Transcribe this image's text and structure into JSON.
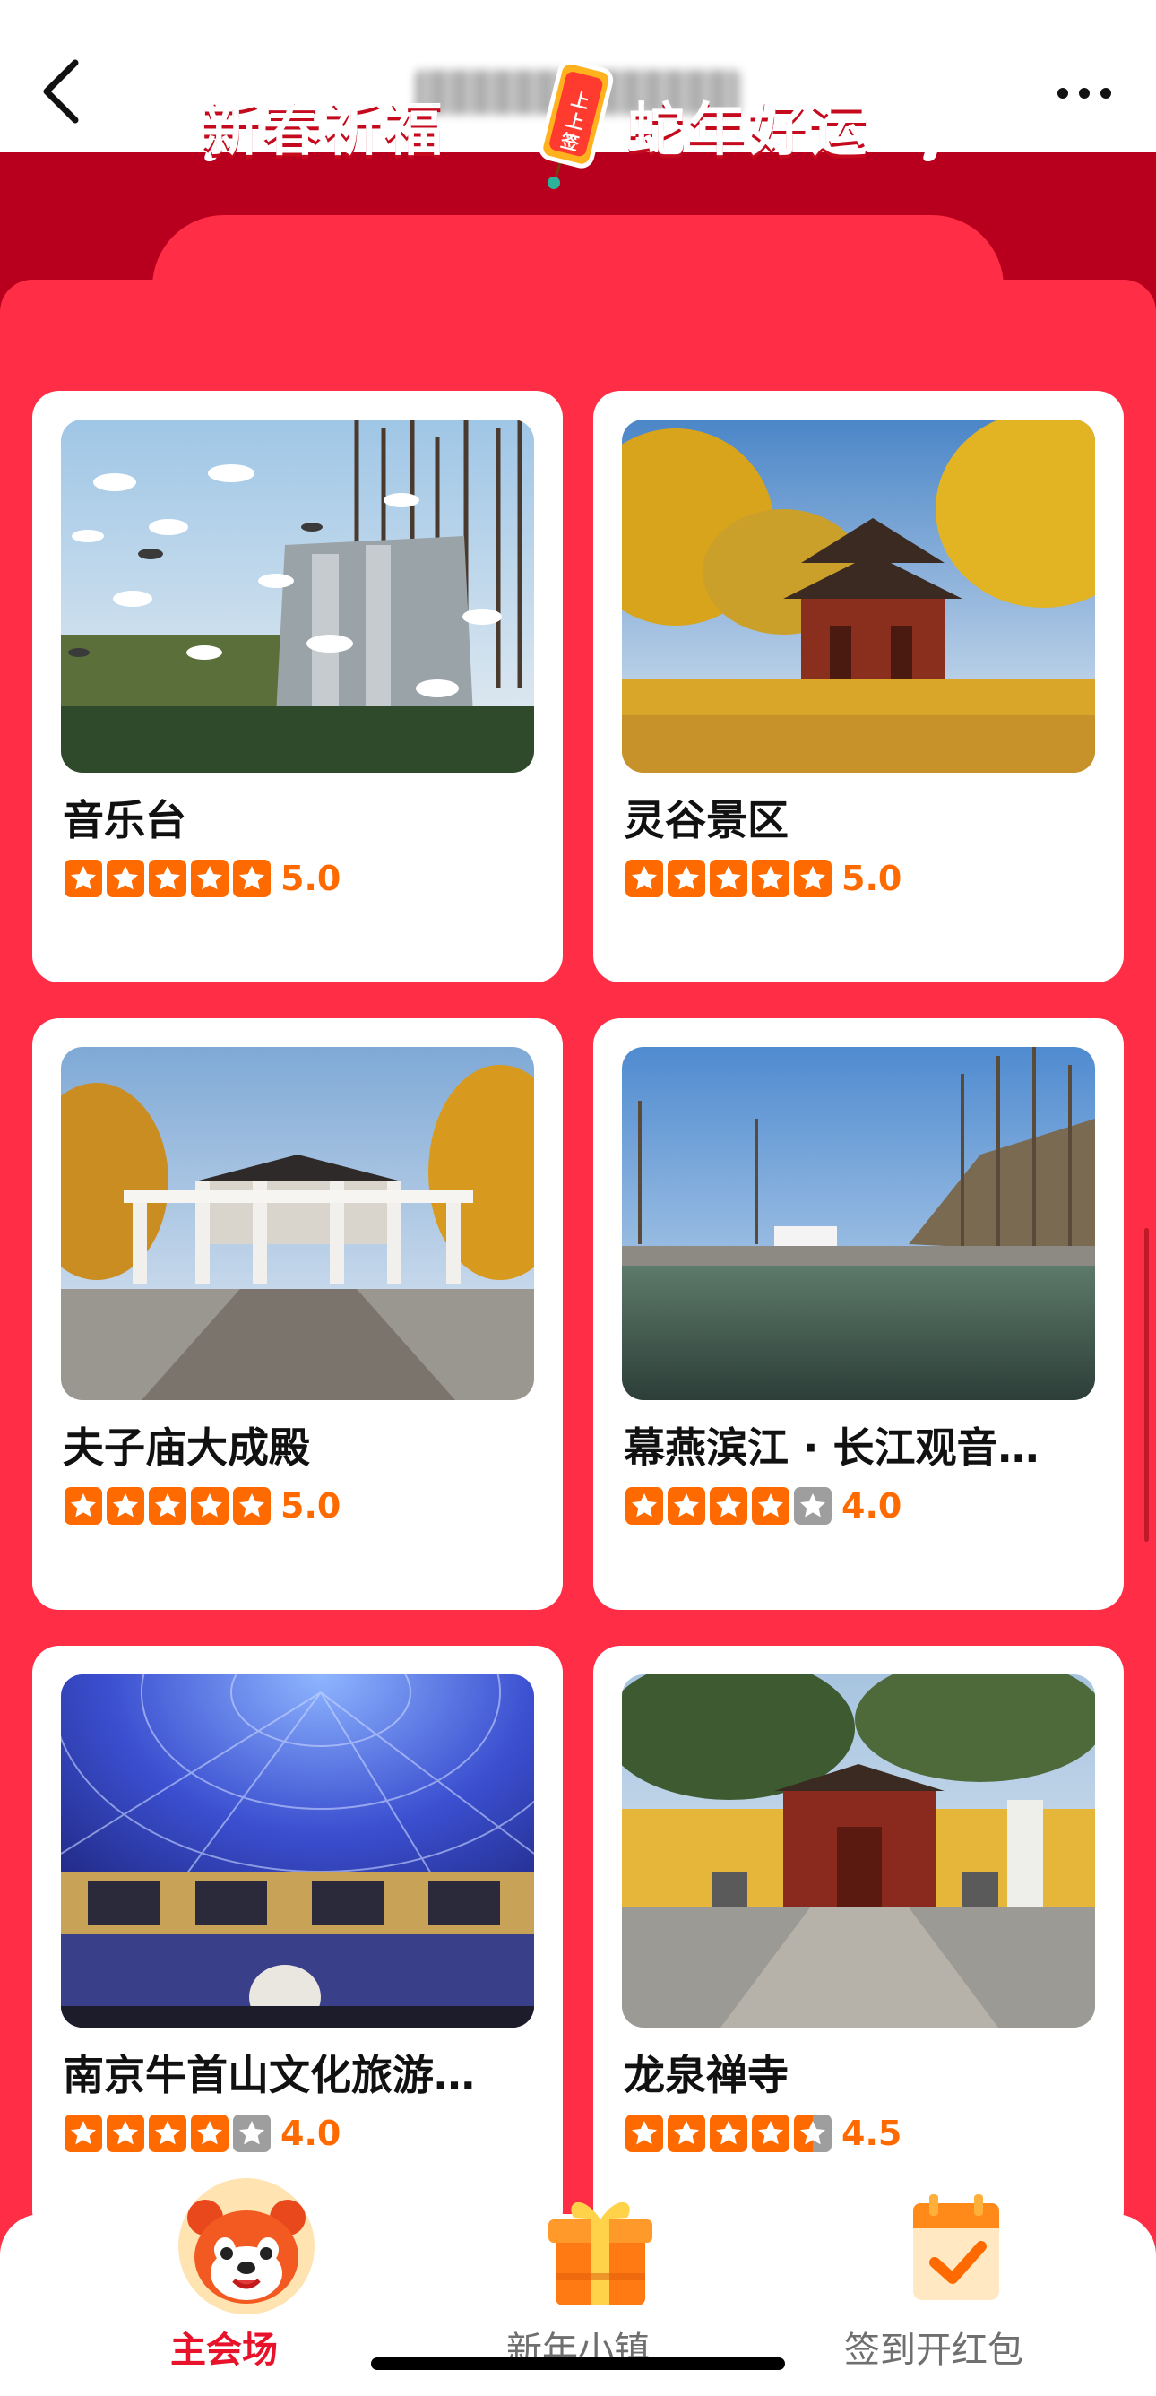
{
  "banner": {
    "left_text": "新春祈福",
    "right_text": "蛇年好运",
    "tag_text": "上上签"
  },
  "places": [
    {
      "name": "音乐台",
      "rating": 5,
      "rating_text": "5.0"
    },
    {
      "name": "灵谷景区",
      "rating": 5,
      "rating_text": "5.0"
    },
    {
      "name": "夫子庙大成殿",
      "rating": 5,
      "rating_text": "5.0"
    },
    {
      "name": "幕燕滨江 · 长江观音…",
      "rating": 4,
      "rating_text": "4.0"
    },
    {
      "name": "南京牛首山文化旅游…",
      "rating": 4,
      "rating_text": "4.0"
    },
    {
      "name": "龙泉禅寺",
      "rating": 4.5,
      "rating_text": "4.5"
    }
  ],
  "tabs": [
    {
      "label": "主会场",
      "active": true,
      "icon": "panda-mascot-icon"
    },
    {
      "label": "新年小镇",
      "active": false,
      "icon": "gift-box-icon"
    },
    {
      "label": "签到开红包",
      "active": false,
      "icon": "calendar-check-icon"
    }
  ],
  "colors": {
    "accent_red": "#ff2d45",
    "dark_red": "#b8001e",
    "star_orange": "#ff6a00",
    "active_tab": "#e8122a"
  }
}
